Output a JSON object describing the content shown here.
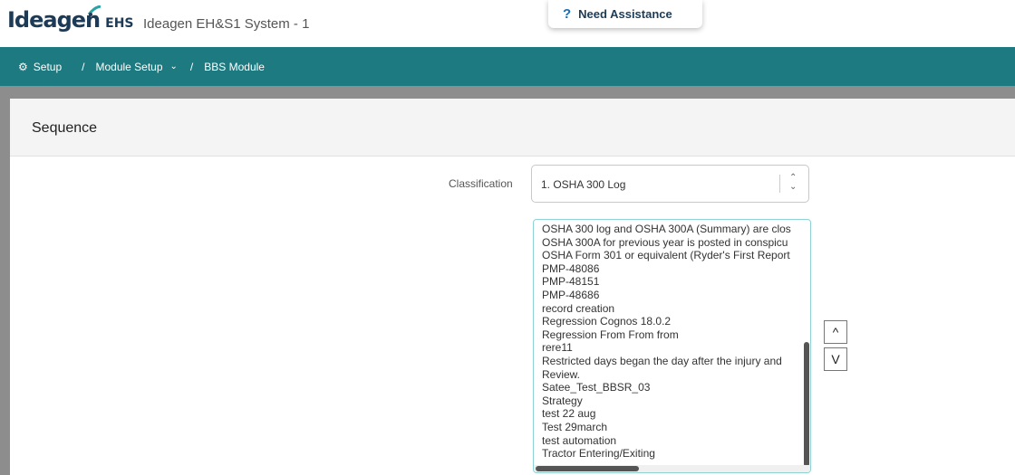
{
  "header": {
    "logo_text": "Ideagen",
    "logo_suffix": "EHS",
    "app_title": "Ideagen EH&S1 System - 1",
    "assist_icon": "?",
    "assist_label": "Need Assistance"
  },
  "breadcrumb": {
    "setup_icon": "gear-icon",
    "setup_label": "Setup",
    "separator": "/",
    "module_setup_label": "Module Setup",
    "module_label": "BBS Module"
  },
  "panel": {
    "title": "Sequence",
    "classification_label": "Classification",
    "classification_value": "1. OSHA 300 Log"
  },
  "list": {
    "items": [
      "OSHA 300 log and OSHA 300A (Summary) are clos",
      "OSHA 300A for previous year is posted in conspicu",
      "OSHA Form 301 or equivalent (Ryder's First Report",
      "PMP-48086",
      "PMP-48151",
      "PMP-48686",
      "record creation",
      "Regression Cognos 18.0.2",
      "Regression From From from",
      "rere11",
      "Restricted days began the day after the injury and",
      "Review.",
      "Satee_Test_BBSR_03",
      "Strategy",
      "test 22 aug",
      "Test 29march",
      "test automation",
      "Tractor Entering/Exiting"
    ]
  },
  "buttons": {
    "move_up": "^",
    "move_down": "V"
  },
  "colors": {
    "nav": "#1d7a80",
    "brand_text": "#1d3b57",
    "accent_blue": "#1a6fb3"
  }
}
